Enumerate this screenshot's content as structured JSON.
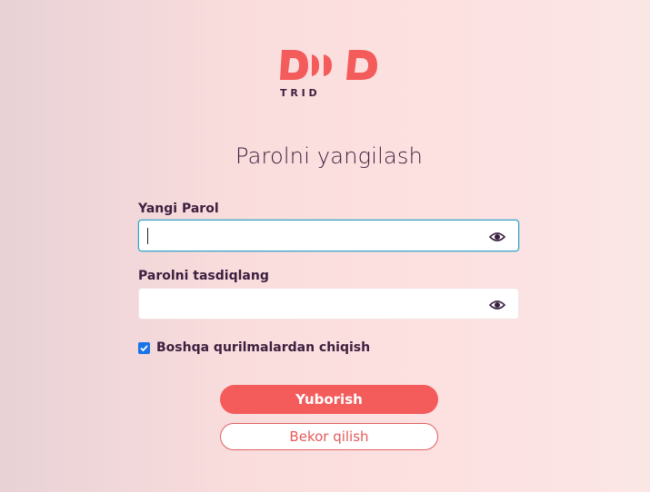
{
  "brand": {
    "logo_text": "DDD",
    "tagline": "T R I D",
    "accent_color": "#f45b5b"
  },
  "page": {
    "title": "Parolni yangilash"
  },
  "form": {
    "new_password": {
      "label": "Yangi Parol",
      "value": "",
      "placeholder": "",
      "icon": "eye-icon"
    },
    "confirm_password": {
      "label": "Parolni tasdiqlang",
      "value": "",
      "placeholder": "",
      "icon": "eye-icon"
    },
    "logout_other_devices": {
      "label": "Boshqa qurilmalardan chiqish",
      "checked": true
    },
    "submit_label": "Yuborish",
    "cancel_label": "Bekor qilish"
  }
}
